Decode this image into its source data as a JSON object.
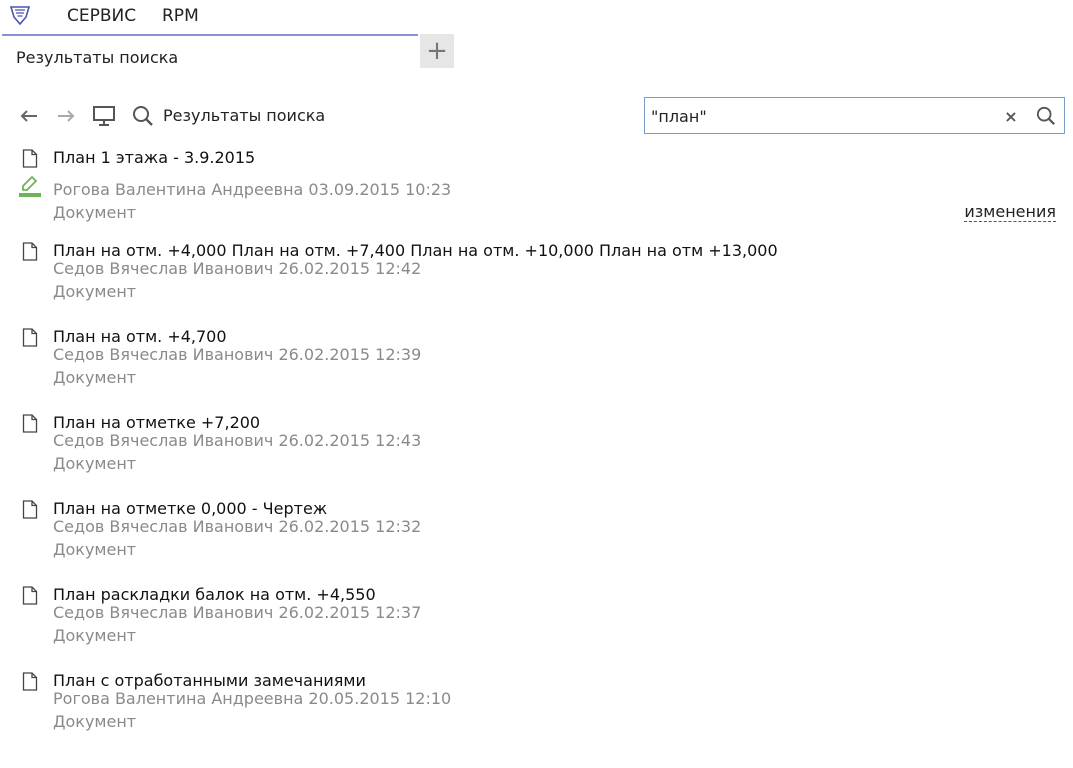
{
  "menu": {
    "items": [
      "СЕРВИС",
      "RPM"
    ]
  },
  "tabs": {
    "active_label": "Результаты поиска",
    "add_label": "+"
  },
  "toolbar": {
    "title": "Результаты поиска"
  },
  "search": {
    "value": "\"план\"",
    "clear_label": "×"
  },
  "colors": {
    "accent": "#8c8fd4",
    "search_border": "#7a9cc8",
    "sign_icon": "#6db45a",
    "meta_text": "#8a8a8a"
  },
  "results": [
    {
      "title": "План 1 этажа - 3.9.2015",
      "meta": "Рогова Валентина Андреевна 03.09.2015 10:23",
      "type": "Документ",
      "signed": true,
      "action": "изменения"
    },
    {
      "title": "План на отм. +4,000 План на отм. +7,400 План на отм. +10,000 План на отм +13,000",
      "meta": "Седов Вячеслав Иванович 26.02.2015 12:42",
      "type": "Документ"
    },
    {
      "title": "План на отм. +4,700",
      "meta": "Седов Вячеслав Иванович 26.02.2015 12:39",
      "type": "Документ"
    },
    {
      "title": "План на отметке +7,200",
      "meta": "Седов Вячеслав Иванович 26.02.2015 12:43",
      "type": "Документ"
    },
    {
      "title": "План на отметке 0,000  - Чертеж",
      "meta": "Седов Вячеслав Иванович 26.02.2015 12:32",
      "type": "Документ"
    },
    {
      "title": "План раскладки балок на отм. +4,550",
      "meta": "Седов Вячеслав Иванович 26.02.2015 12:37",
      "type": "Документ"
    },
    {
      "title": "План с отработанными замечаниями",
      "meta": "Рогова Валентина Андреевна 20.05.2015 12:10",
      "type": "Документ"
    }
  ]
}
